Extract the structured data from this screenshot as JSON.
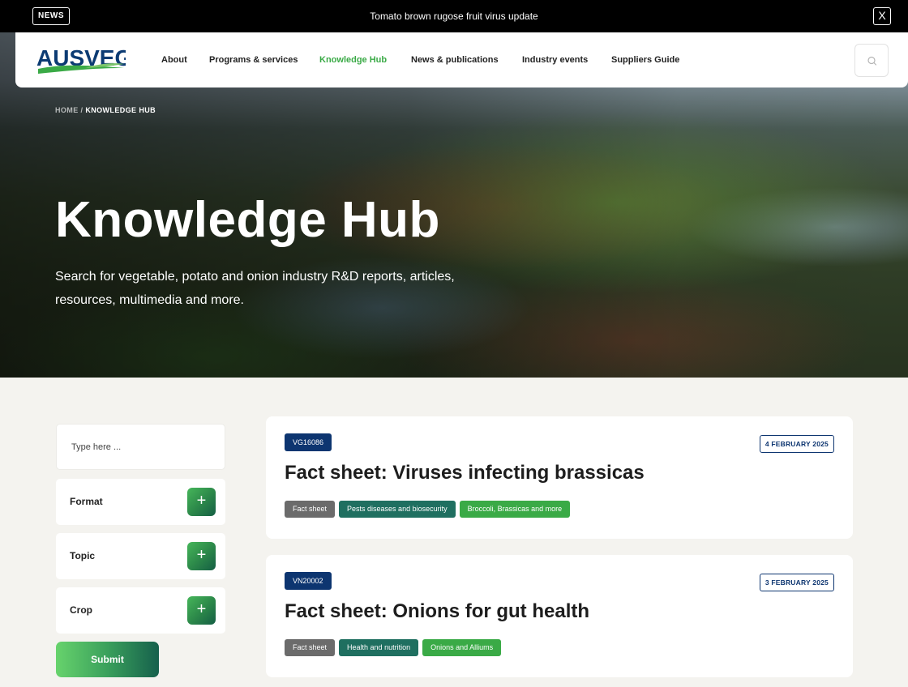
{
  "news_bar": {
    "badge": "NEWS",
    "text": "Tomato brown rugose fruit virus update",
    "close_label": "X"
  },
  "header": {
    "logo_text": "AUSVEG",
    "nav": [
      {
        "label": "About"
      },
      {
        "label": "Programs & services"
      },
      {
        "label": "Knowledge Hub"
      },
      {
        "label": "News & publications"
      },
      {
        "label": "Industry events"
      },
      {
        "label": "Suppliers Guide"
      }
    ],
    "active_nav": "Knowledge Hub"
  },
  "hero": {
    "breadcrumb": {
      "home": "HOME",
      "separator": "/",
      "current": "KNOWLEDGE HUB"
    },
    "title": "Knowledge Hub",
    "subtitle": "Search for vegetable, potato and onion industry R&D reports, articles, resources, multimedia and more."
  },
  "sidebar": {
    "search_placeholder": "Type here ...",
    "filters": [
      {
        "label": "Format",
        "toggle": "+"
      },
      {
        "label": "Topic",
        "toggle": "+"
      },
      {
        "label": "Crop",
        "toggle": "+"
      }
    ],
    "submit_label": "Submit"
  },
  "results": [
    {
      "code": "VG16086",
      "date": "4 FEBRUARY 2025",
      "title": "Fact sheet: Viruses infecting brassicas",
      "format_tag": "Fact sheet",
      "topic_tag": "Pests diseases and biosecurity",
      "crop_tag": "Broccoli, Brassicas and more"
    },
    {
      "code": "VN20002",
      "date": "3 FEBRUARY 2025",
      "title": "Fact sheet: Onions for gut health",
      "format_tag": "Fact sheet",
      "topic_tag": "Health and nutrition",
      "crop_tag": "Onions and Alliums"
    }
  ],
  "colors": {
    "accent_green": "#3aaa46",
    "navy": "#0d3570",
    "topic_teal": "#1f6f60",
    "format_grey": "#6b6b6b",
    "logo_blue": "#0c3b73"
  }
}
